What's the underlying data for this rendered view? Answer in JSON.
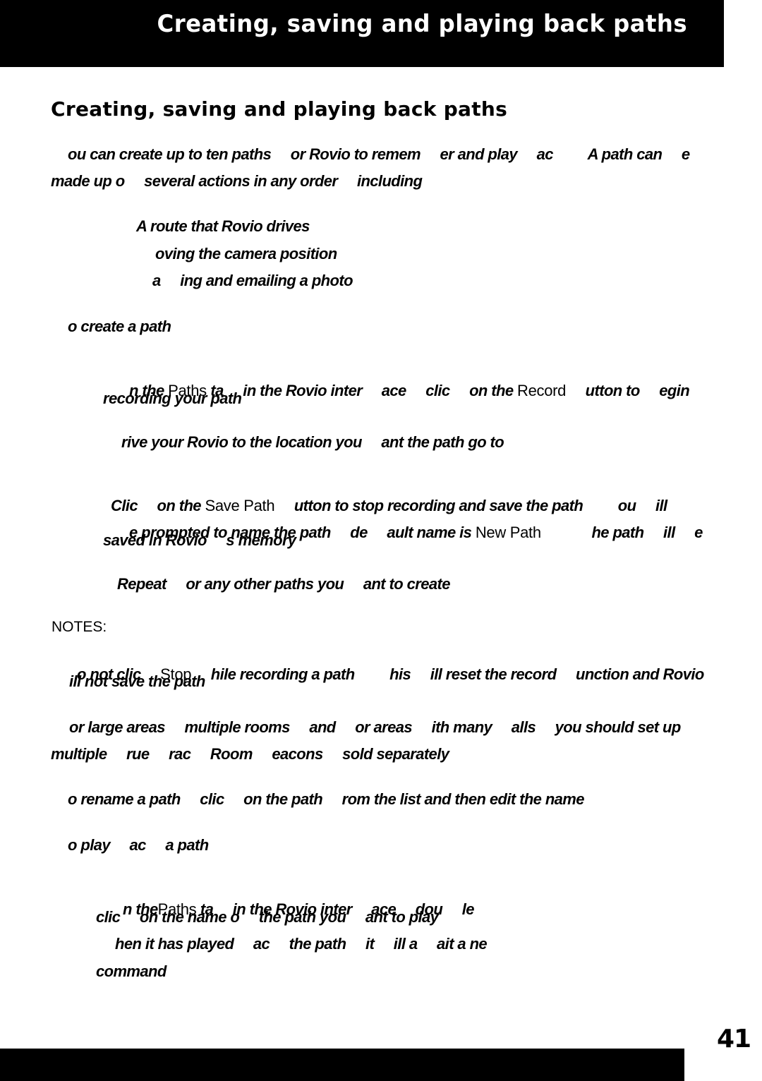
{
  "header": {
    "title": "Creating, saving and playing back paths"
  },
  "section": {
    "title": "Creating, saving and playing back paths"
  },
  "intro": {
    "line1": "ou can create up to ten paths     or Rovio to remem     er and play     ac         A path can     e",
    "line2": "made up o     several actions in any order     including"
  },
  "actions": [
    "A route that Rovio drives",
    "oving the camera position",
    "a     ing and emailing a photo"
  ],
  "create_heading": "o create a path",
  "steps": {
    "step1": {
      "seg1": "n the ",
      "tab_name": "Paths",
      "seg2": " ta     in the Rovio inter     ace     clic     on the ",
      "button_name": "Record",
      "seg3": "     utton to     egin",
      "line2": "recording your path"
    },
    "step2": "rive your Rovio to the location you     ant the path go to",
    "step3": {
      "seg1": "Clic     on the ",
      "button_name": "Save Path",
      "seg2": "     utton to stop recording and save the path         ou     ill",
      "line2_seg1": "e prompted to name the path     de     ault name is ",
      "default_name": "New Path",
      "line2_seg2": "             he path     ill     e",
      "line3": "saved in Rovio     s memory"
    },
    "step4": "Repeat     or any other paths you     ant to create"
  },
  "notes": {
    "label": "NOTES:",
    "note1": {
      "seg1": "o not clic     ",
      "button_name": "Stop",
      "seg2": "     hile recording a path         his     ill reset the record     unction and Rovio",
      "line2": "ill not save the path"
    },
    "note2": {
      "line1": "or large areas     multiple rooms     and     or areas     ith many     alls     you should set up",
      "line2": "multiple     rue     rac     Room     eacons     sold separately"
    },
    "note3": "o rename a path     clic     on the path     rom the list and then edit the name"
  },
  "play_heading": "o play     ac     a path",
  "play": {
    "line1_seg1": "n the",
    "tab_name": "Paths",
    "line1_seg2": " ta     in the Rovio inter     ace     dou     le",
    "line2": "clic     on the name o     the path you     ant to play",
    "line3": "hen it has played     ac     the path     it     ill a     ait a ne",
    "line4": "command"
  },
  "footer": {
    "page_number": "41"
  }
}
